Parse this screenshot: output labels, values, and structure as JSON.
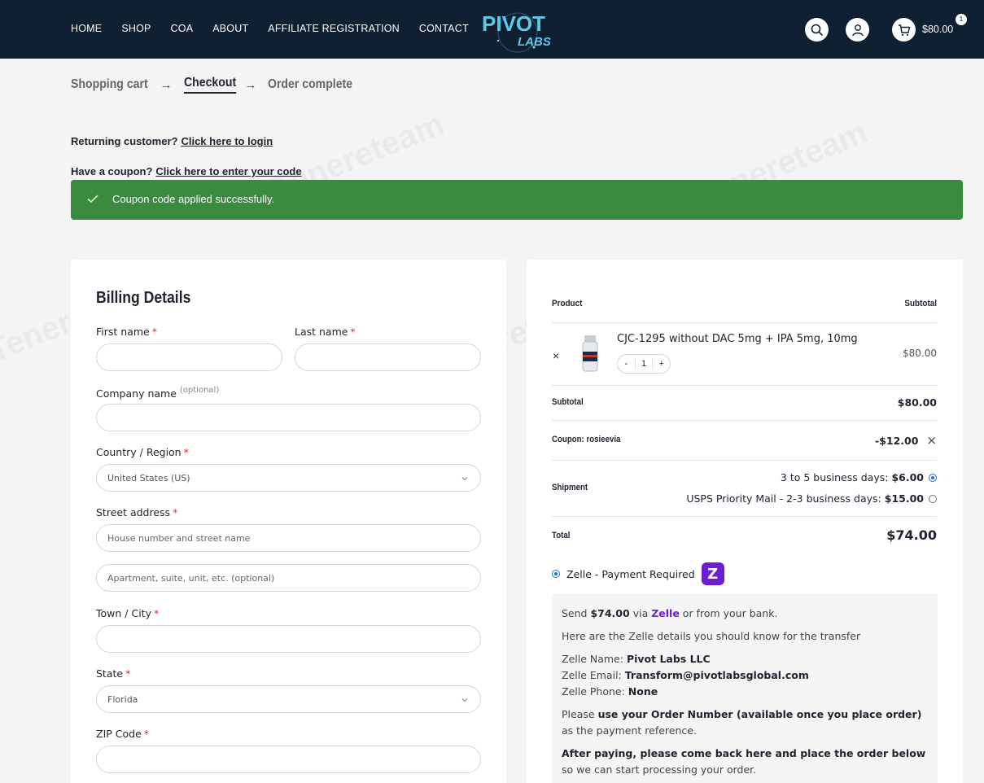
{
  "header": {
    "nav": [
      "HOME",
      "SHOP",
      "COA",
      "ABOUT",
      "AFFILIATE REGISTRATION",
      "CONTACT"
    ],
    "logo_text_top": "PIVOT",
    "logo_text_bottom": "LABS",
    "cart_amount": "$80.00",
    "cart_count": "1"
  },
  "steps": {
    "cart": "Shopping cart",
    "checkout": "Checkout",
    "complete": "Order complete"
  },
  "notices": {
    "returning_text": "Returning customer?",
    "returning_link": "Click here to login",
    "coupon_text": "Have a coupon?",
    "coupon_link": "Click here to enter your code",
    "success_message": "Coupon code applied successfully."
  },
  "billing": {
    "title": "Billing Details",
    "first_name_label": "First name",
    "last_name_label": "Last name",
    "company_label": "Company name",
    "optional": "(optional)",
    "country_label": "Country / Region",
    "country_value": "United States (US)",
    "street_label": "Street address",
    "street_placeholder": "House number and street name",
    "apt_placeholder": "Apartment, suite, unit, etc. (optional)",
    "city_label": "Town / City",
    "state_label": "State",
    "state_value": "Florida",
    "zip_label": "ZIP Code",
    "required_mark": "*"
  },
  "order": {
    "col_product": "Product",
    "col_subtotal": "Subtotal",
    "remove_symbol": "×",
    "product_name": "CJC-1295 without DAC 5mg + IPA 5mg, 10mg",
    "qty_minus": "-",
    "qty_value": "1",
    "qty_plus": "+",
    "product_price": "$80.00",
    "subtotal_label": "Subtotal",
    "subtotal_value": "$80.00",
    "coupon_label": "Coupon: rosieevia",
    "coupon_value": "-$12.00",
    "coupon_remove": "×",
    "shipment_label": "Shipment",
    "ship_option_1_text": "3 to 5 business days:",
    "ship_option_1_price": "$6.00",
    "ship_option_2_text": "USPS Priority Mail - 2-3 business days:",
    "ship_option_2_price": "$15.00",
    "total_label": "Total",
    "total_value": "$74.00",
    "payment_method": "Zelle - Payment Required",
    "zelle_badge": "Z"
  },
  "payment_info": {
    "send_prefix": "Send",
    "send_amount": "$74.00",
    "send_via": "via",
    "send_zelle": "Zelle",
    "send_suffix": "or from your bank.",
    "details_intro": "Here are the Zelle details you should know for the transfer",
    "name_label": "Zelle Name:",
    "name_value": "Pivot Labs LLC",
    "email_label": "Zelle Email:",
    "email_value": "Transform@pivotlabsglobal.com",
    "phone_label": "Zelle Phone:",
    "phone_value": "None",
    "ref_prefix": "Please",
    "ref_bold": "use your Order Number (available once you place order)",
    "ref_suffix": "as the payment reference.",
    "after_bold": "After paying, please come back here and place the order below",
    "after_suffix": "so we can start processing your order."
  },
  "watermark": "Tenereteam",
  "colors": {
    "header_bg": "#0f2033",
    "success_bg": "#3a8a3f",
    "zelle_purple": "#6d1ed4",
    "radio_blue": "#1a73e8",
    "required_red": "#d0312d"
  }
}
